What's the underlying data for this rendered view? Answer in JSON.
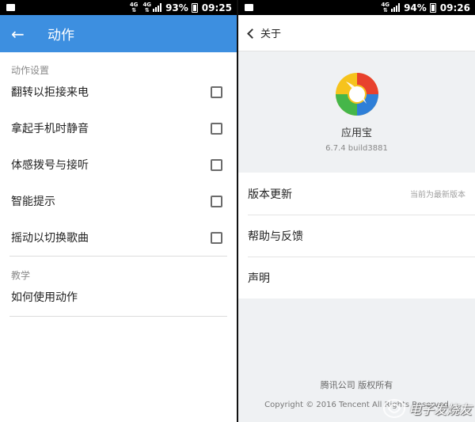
{
  "left": {
    "status": {
      "network": "4G",
      "network2": "4G",
      "battery": "93%",
      "time": "09:25"
    },
    "appbar": {
      "title": "动作"
    },
    "sections": [
      {
        "header": "动作设置",
        "items": [
          "翻转以拒接来电",
          "拿起手机时静音",
          "体感拨号与接听",
          "智能提示",
          "摇动以切换歌曲"
        ]
      },
      {
        "header": "教学",
        "items": [
          "如何使用动作"
        ]
      }
    ]
  },
  "right": {
    "status": {
      "network": "4G",
      "battery": "94%",
      "time": "09:26"
    },
    "bar": {
      "title": "关于"
    },
    "app": {
      "name": "应用宝",
      "version": "6.7.4 build3881"
    },
    "menu": [
      {
        "label": "版本更新",
        "value": "当前为最新版本"
      },
      {
        "label": "帮助与反馈"
      },
      {
        "label": "声明"
      }
    ],
    "footer": {
      "company": "腾讯公司 版权所有",
      "copyright": "Copyright © 2016 Tencent All Rights Reserved"
    }
  },
  "watermark": {
    "text": "电子发烧友"
  },
  "colors": {
    "appbar": "#3d8fe0",
    "logo_blue": "#2e7fd8",
    "logo_red": "#e8412d",
    "logo_yellow": "#f6c31c",
    "logo_green": "#45b649"
  }
}
